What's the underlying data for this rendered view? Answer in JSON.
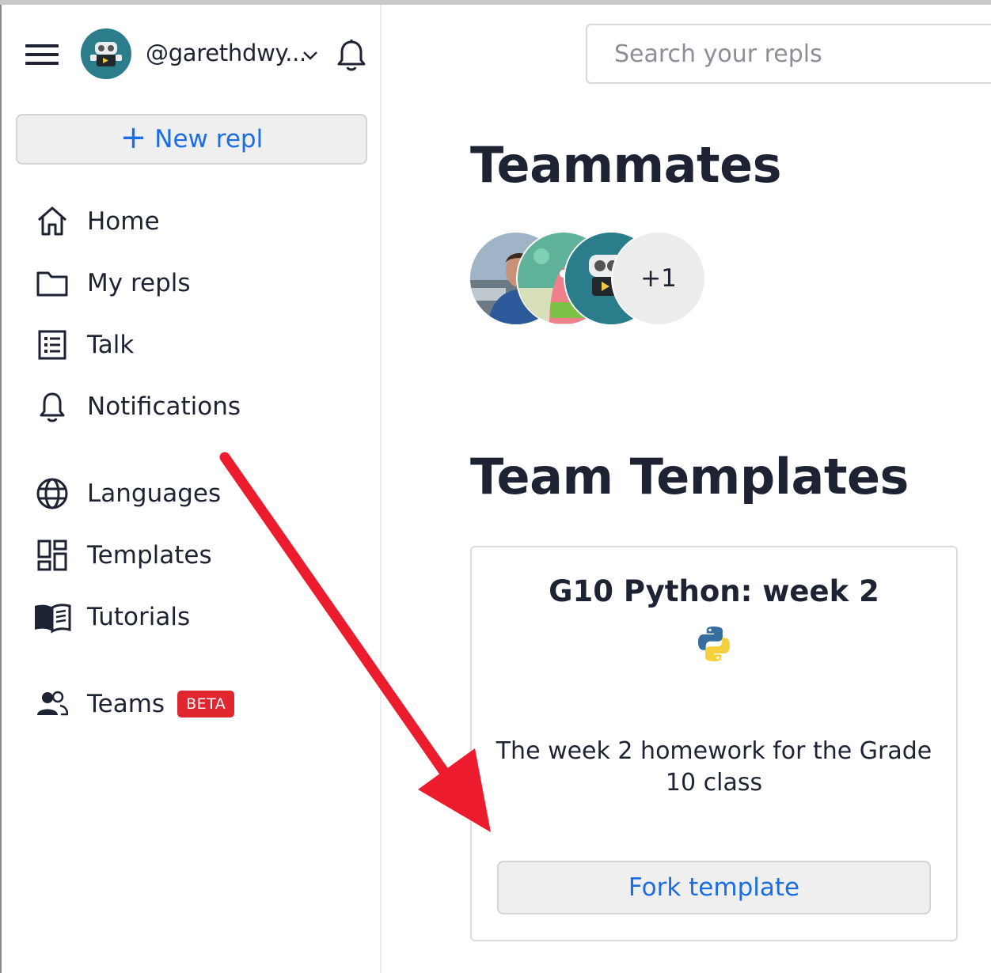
{
  "sidebar": {
    "username": "@garethdwy...",
    "new_repl_label": "New repl",
    "new_repl_icon": "plus-icon",
    "nav_primary": [
      {
        "label": "Home",
        "icon": "home-icon"
      },
      {
        "label": "My repls",
        "icon": "folder-icon"
      },
      {
        "label": "Talk",
        "icon": "list-icon"
      },
      {
        "label": "Notifications",
        "icon": "bell-icon"
      }
    ],
    "nav_secondary": [
      {
        "label": "Languages",
        "icon": "globe-icon"
      },
      {
        "label": "Templates",
        "icon": "templates-icon"
      },
      {
        "label": "Tutorials",
        "icon": "book-icon"
      }
    ],
    "teams": {
      "label": "Teams",
      "badge": "BETA",
      "icon": "people-icon"
    }
  },
  "search": {
    "placeholder": "Search your repls",
    "value": ""
  },
  "main": {
    "teammates_heading": "Teammates",
    "teammates_more": "+1",
    "team_templates_heading": "Team Templates",
    "template_card": {
      "title": "G10 Python: week 2",
      "language_icon": "python-icon",
      "description": "The week 2 homework for the Grade 10 class",
      "fork_label": "Fork template"
    }
  },
  "colors": {
    "accent": "#1a6de3",
    "badge_red": "#e0262f",
    "annotation_arrow": "#ec1c2e",
    "avatar_teal": "#2b7d8b"
  }
}
